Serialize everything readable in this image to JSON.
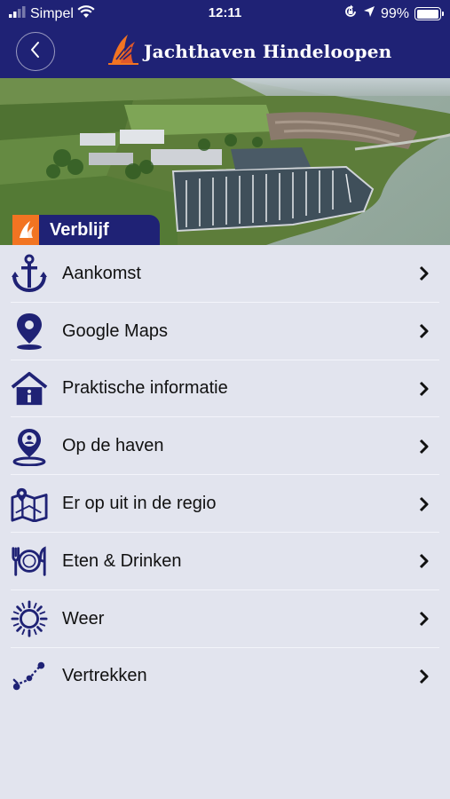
{
  "status_bar": {
    "carrier": "Simpel",
    "time": "12:11",
    "battery": "99%",
    "battery_level": 0.99,
    "icons": [
      "signal-icon",
      "wifi-icon",
      "orientation-lock-icon",
      "location-icon",
      "battery-icon"
    ]
  },
  "navbar": {
    "title": "Jachthaven Hindeloopen",
    "back_icon": "chevron-left-icon"
  },
  "section": {
    "label": "Verblijf"
  },
  "menu": [
    {
      "label": "Aankomst",
      "icon": "anchor-icon"
    },
    {
      "label": "Google Maps",
      "icon": "map-pin-icon"
    },
    {
      "label": "Praktische informatie",
      "icon": "info-house-icon"
    },
    {
      "label": "Op de haven",
      "icon": "location-person-icon"
    },
    {
      "label": "Er op uit in de regio",
      "icon": "folded-map-icon"
    },
    {
      "label": "Eten & Drinken",
      "icon": "fork-plate-knife-icon"
    },
    {
      "label": "Weer",
      "icon": "sun-icon"
    },
    {
      "label": "Vertrekken",
      "icon": "route-icon"
    }
  ],
  "colors": {
    "brand_navy": "#1f2275",
    "accent_orange": "#f27422",
    "background": "#e2e4ee"
  }
}
